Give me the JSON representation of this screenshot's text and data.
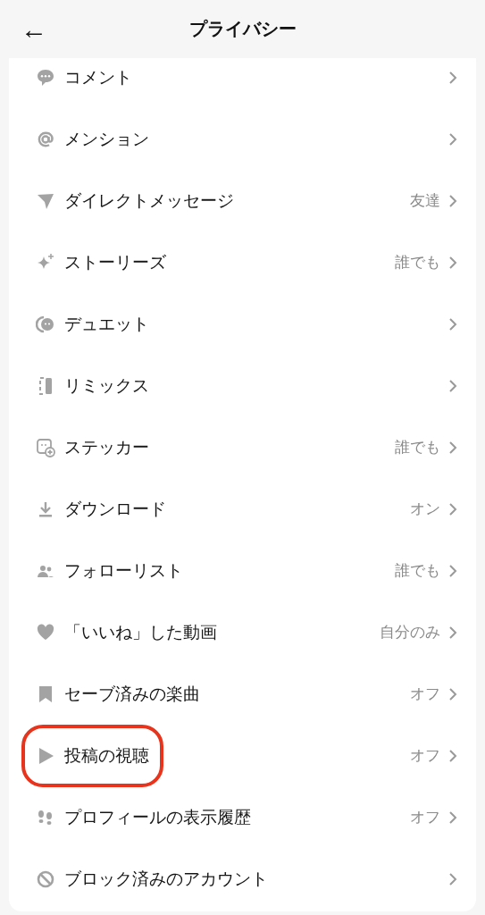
{
  "header": {
    "back": "←",
    "title": "プライバシー"
  },
  "rows": [
    {
      "kind": "comment",
      "label": "コメント",
      "highlighted": false
    },
    {
      "kind": "at",
      "label": "メンション",
      "highlighted": false
    },
    {
      "kind": "send",
      "label": "ダイレクトメッセージ",
      "value": "友達",
      "highlighted": false
    },
    {
      "kind": "sparkle",
      "label": "ストーリーズ",
      "value": "誰でも",
      "highlighted": false
    },
    {
      "kind": "duet",
      "label": "デュエット",
      "highlighted": false
    },
    {
      "kind": "remix",
      "label": "リミックス",
      "highlighted": false
    },
    {
      "kind": "sticker",
      "label": "ステッカー",
      "value": "誰でも",
      "highlighted": false
    },
    {
      "kind": "download",
      "label": "ダウンロード",
      "value": "オン",
      "highlighted": false
    },
    {
      "kind": "people",
      "label": "フォローリスト",
      "value": "誰でも",
      "highlighted": false
    },
    {
      "kind": "heart",
      "label": "「いいね」した動画",
      "value": "自分のみ",
      "highlighted": false
    },
    {
      "kind": "bookmark",
      "label": "セーブ済みの楽曲",
      "value": "オフ",
      "highlighted": false
    },
    {
      "kind": "play",
      "label": "投稿の視聴",
      "value": "オフ",
      "highlighted": true
    },
    {
      "kind": "footprints",
      "label": "プロフィールの表示履歴",
      "value": "オフ",
      "highlighted": false
    },
    {
      "kind": "block",
      "label": "ブロック済みのアカウント",
      "highlighted": false
    }
  ]
}
